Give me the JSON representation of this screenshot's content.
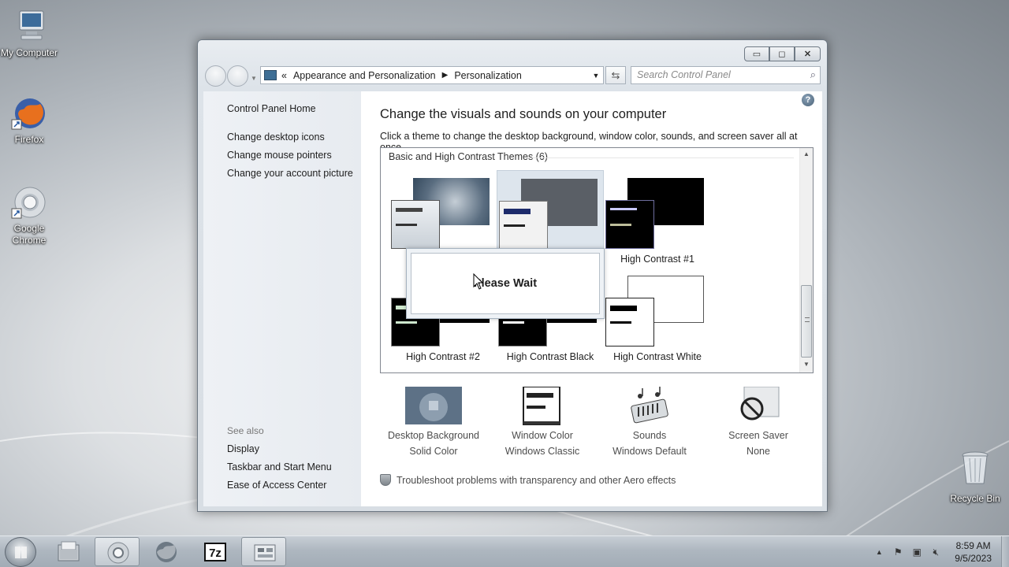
{
  "desktop": {
    "icons": [
      {
        "label": "My Computer",
        "icon": "computer-icon"
      },
      {
        "label": "Firefox",
        "icon": "firefox-icon"
      },
      {
        "label": "Google Chrome",
        "icon": "chrome-icon"
      },
      {
        "label": "Recycle Bin",
        "icon": "recycle-bin-icon"
      }
    ]
  },
  "window": {
    "caption": {
      "minimize": "▭",
      "maximize": "◻",
      "close": "✕"
    },
    "address": {
      "root_glyph": "«",
      "crumbs": [
        "Appearance and Personalization",
        "Personalization"
      ],
      "separator": "▶"
    },
    "search": {
      "placeholder": "Search Control Panel"
    },
    "left_pane": {
      "links": [
        "Control Panel Home",
        "Change desktop icons",
        "Change mouse pointers",
        "Change your account picture"
      ],
      "see_also_title": "See also",
      "see_also": [
        "Display",
        "Taskbar and Start Menu",
        "Ease of Access Center"
      ]
    },
    "main": {
      "help": "?",
      "heading": "Change the visuals and sounds on your computer",
      "subheading": "Click a theme to change the desktop background, window color, sounds, and screen saver all at once.",
      "group_title": "Basic and High Contrast Themes (6)",
      "themes": [
        {
          "name": "",
          "selected": false
        },
        {
          "name": "",
          "selected": true
        },
        {
          "name": "High Contrast #1",
          "selected": false
        },
        {
          "name": "High Contrast #2",
          "selected": false
        },
        {
          "name": "High Contrast Black",
          "selected": false
        },
        {
          "name": "High Contrast White",
          "selected": false
        }
      ],
      "dialog": {
        "text": "Please Wait"
      },
      "bottom": [
        {
          "title": "Desktop Background",
          "value": "Solid Color"
        },
        {
          "title": "Window Color",
          "value": "Windows Classic"
        },
        {
          "title": "Sounds",
          "value": "Windows Default"
        },
        {
          "title": "Screen Saver",
          "value": "None"
        }
      ],
      "troubleshoot": "Troubleshoot problems with transparency and other Aero effects"
    }
  },
  "taskbar": {
    "apps": [
      "file-explorer",
      "chrome",
      "firefox",
      "7-zip",
      "control-panel"
    ],
    "active_app": "control-panel",
    "tray_arrow": "▲",
    "clock": {
      "time": "8:59 AM",
      "date": "9/5/2023"
    }
  }
}
